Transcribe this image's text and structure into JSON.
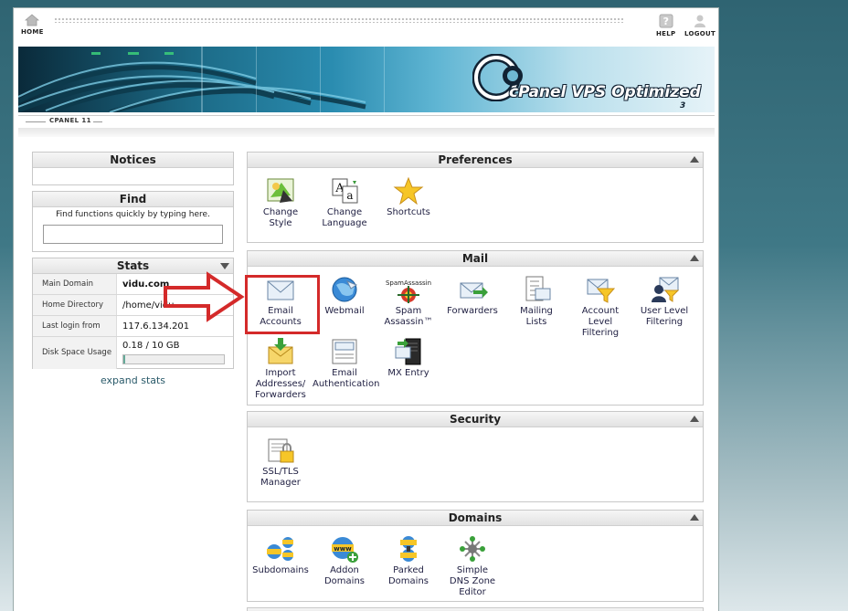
{
  "topbar": {
    "home_label": "HOME",
    "help_label": "HELP",
    "logout_label": "LOGOUT"
  },
  "banner": {
    "logo_text": "cPanel VPS Optimized",
    "logo_sub": "3"
  },
  "version": "CPANEL 11",
  "notices": {
    "title": "Notices"
  },
  "find": {
    "title": "Find",
    "hint": "Find functions quickly by typing here.",
    "placeholder": ""
  },
  "stats": {
    "title": "Stats",
    "rows": [
      {
        "key": "Main Domain",
        "value": "vidu.com"
      },
      {
        "key": "Home Directory",
        "value": "/home/vidu"
      },
      {
        "key": "Last login from",
        "value": "117.6.134.201"
      },
      {
        "key": "Disk Space Usage",
        "value": "0.18 / 10 GB"
      }
    ],
    "disk_usage_fraction": 0.018,
    "expand": "expand stats"
  },
  "preferences": {
    "title": "Preferences",
    "items": [
      {
        "label1": "Change",
        "label2": "Style"
      },
      {
        "label1": "Change",
        "label2": "Language"
      },
      {
        "label1": "Shortcuts"
      }
    ]
  },
  "mail": {
    "title": "Mail",
    "spam_brand": "SpamAssassin",
    "items": [
      {
        "label1": "Email",
        "label2": "Accounts"
      },
      {
        "label1": "Webmail"
      },
      {
        "label1": "Spam",
        "label2": "Assassin™"
      },
      {
        "label1": "Forwarders"
      },
      {
        "label1": "Mailing",
        "label2": "Lists"
      },
      {
        "label1": "Account",
        "label2": "Level",
        "label3": "Filtering"
      },
      {
        "label1": "User Level",
        "label2": "Filtering"
      },
      {
        "label1": "Import",
        "label2": "Addresses/",
        "label3": "Forwarders"
      },
      {
        "label1": "Email",
        "label2": "Authentication"
      },
      {
        "label1": "MX Entry"
      }
    ]
  },
  "security": {
    "title": "Security",
    "items": [
      {
        "label1": "SSL/TLS",
        "label2": "Manager"
      }
    ]
  },
  "domains": {
    "title": "Domains",
    "www": "www",
    "items": [
      {
        "label1": "Subdomains"
      },
      {
        "label1": "Addon",
        "label2": "Domains"
      },
      {
        "label1": "Parked",
        "label2": "Domains"
      },
      {
        "label1": "Simple",
        "label2": "DNS Zone",
        "label3": "Editor"
      }
    ]
  },
  "colors": {
    "highlight": "#d42a2a",
    "panel_head": "#e4e4e4",
    "link": "#2a5a6a"
  }
}
